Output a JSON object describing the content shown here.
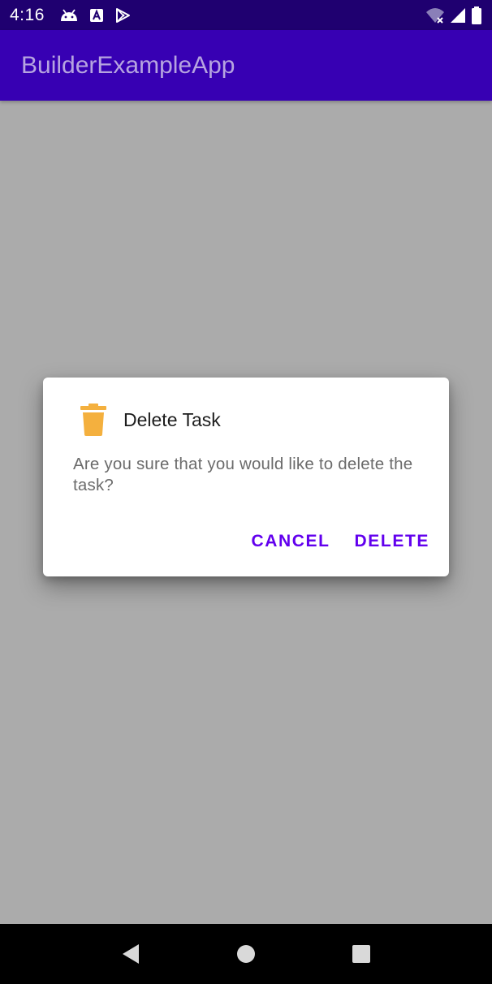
{
  "status_bar": {
    "time": "4:16",
    "left_icons": [
      "android-debug-icon",
      "font-a-icon",
      "play-store-icon"
    ],
    "right_icons": [
      "wifi-off-icon",
      "cellular-signal-icon",
      "battery-icon"
    ]
  },
  "app_bar": {
    "title": "BuilderExampleApp",
    "background_color": "#3700b3"
  },
  "dialog": {
    "icon": "trash-icon",
    "icon_color": "#f4b03e",
    "title": "Delete Task",
    "message": "Are you sure that you would like to delete the task?",
    "buttons": {
      "cancel": "CANCEL",
      "delete": "DELETE"
    },
    "accent_color": "#6200ee"
  },
  "nav_bar": {
    "buttons": [
      "back-icon",
      "home-icon",
      "recents-icon"
    ]
  }
}
